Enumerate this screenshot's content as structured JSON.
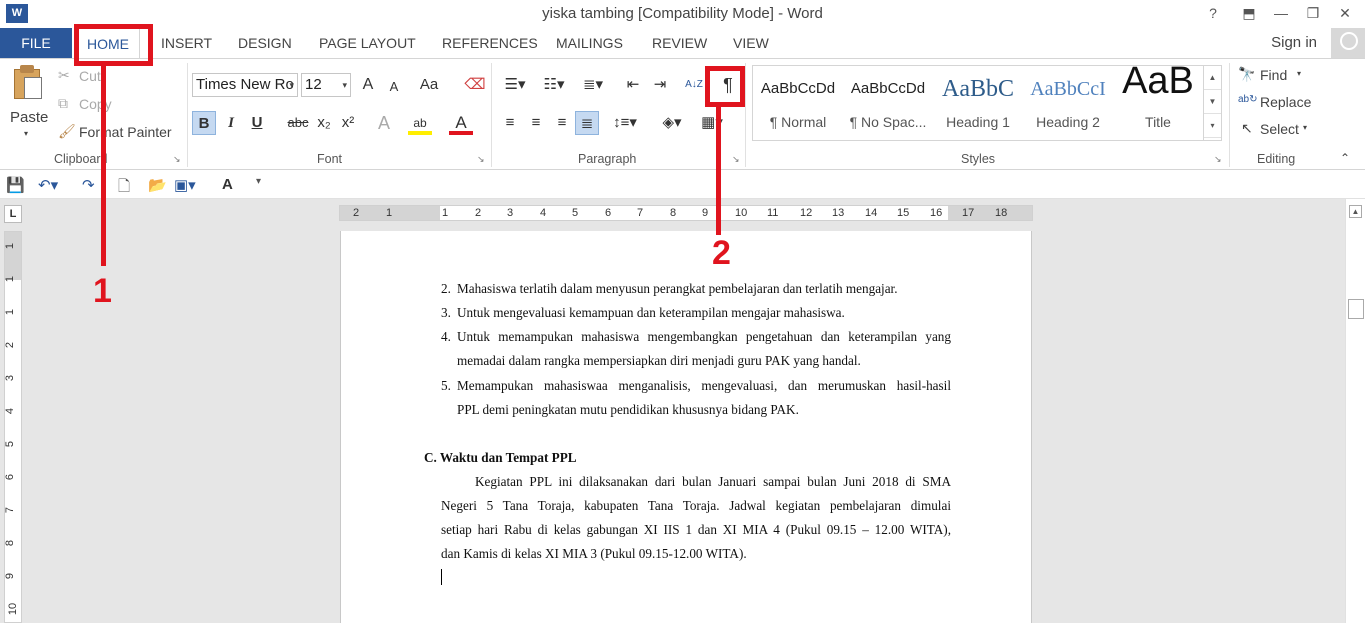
{
  "window": {
    "title": "yiska tambing [Compatibility Mode] - Word",
    "logo": "W",
    "help": "?",
    "restore_ribbon": "⬒",
    "minimize": "—",
    "maximize": "❐",
    "close": "✕"
  },
  "tabs": {
    "file": "FILE",
    "home": "HOME",
    "insert": "INSERT",
    "design": "DESIGN",
    "page_layout": "PAGE LAYOUT",
    "references": "REFERENCES",
    "mailings": "MAILINGS",
    "review": "REVIEW",
    "view": "VIEW",
    "sign_in": "Sign in"
  },
  "clipboard": {
    "paste": "Paste",
    "cut": "Cut",
    "copy": "Copy",
    "format_painter": "Format Painter",
    "label": "Clipboard"
  },
  "font": {
    "name": "Times New Ro",
    "size": "12",
    "grow": "A",
    "shrink": "A",
    "change_case": "Aa",
    "bold": "B",
    "italic": "I",
    "underline": "U",
    "strike": "abc",
    "subscript": "x₂",
    "superscript": "x²",
    "effects": "A",
    "highlight": "ab",
    "color": "A",
    "label": "Font"
  },
  "paragraph": {
    "show_hide": "¶",
    "sort": "A↓Z",
    "label": "Paragraph"
  },
  "styles": {
    "items": [
      {
        "sample": "AaBbCcDd",
        "name": "¶ Normal"
      },
      {
        "sample": "AaBbCcDd",
        "name": "¶ No Spac..."
      },
      {
        "sample": "AaBbC",
        "name": "Heading 1"
      },
      {
        "sample": "AaBbCcI",
        "name": "Heading 2"
      },
      {
        "sample": "AaB",
        "name": "Title"
      }
    ],
    "label": "Styles"
  },
  "editing": {
    "find": "Find",
    "replace": "Replace",
    "select": "Select",
    "label": "Editing"
  },
  "ruler": {
    "corner": "L",
    "h_numbers": [
      "2",
      "1",
      "1",
      "2",
      "3",
      "4",
      "5",
      "6",
      "7",
      "8",
      "9",
      "10",
      "11",
      "12",
      "13",
      "14",
      "15",
      "16",
      "17",
      "18"
    ],
    "v_numbers": [
      "1",
      "1",
      "1",
      "2",
      "3",
      "4",
      "5",
      "6",
      "7",
      "8",
      "9",
      "10"
    ]
  },
  "document": {
    "items": [
      {
        "num": "2.",
        "text": "Mahasiswa terlatih dalam menyusun perangkat pembelajaran dan terlatih mengajar."
      },
      {
        "num": "3.",
        "text": "Untuk mengevaluasi kemampuan dan keterampilan mengajar mahasiswa."
      },
      {
        "num": "4.",
        "line1": "Untuk memampukan mahasiswa mengembangkan pengetahuan dan keterampilan yang",
        "line2": "memadai dalam rangka mempersiapkan diri menjadi guru PAK yang handal."
      },
      {
        "num": "5.",
        "line1": "Memampukan mahasiswaa menganalisis, mengevaluasi, dan merumuskan hasil-hasil",
        "line2": "PPL demi peningkatan mutu pendidikan khususnya bidang PAK."
      }
    ],
    "heading": "C. Waktu dan Tempat PPL",
    "para_lines": [
      "Kegiatan PPL ini dilaksanakan dari bulan Januari sampai bulan Juni 2018 di SMA",
      "Negeri 5 Tana Toraja, kabupaten Tana Toraja. Jadwal kegiatan pembelajaran dimulai",
      "setiap hari Rabu di kelas gabungan XI IIS 1 dan XI MIA 4 (Pukul 09.15 – 12.00 WITA),",
      "dan Kamis di kelas XI MIA 3 (Pukul 09.15-12.00 WITA)."
    ]
  },
  "annotations": {
    "one": "1",
    "two": "2",
    "color": "#e0141e"
  }
}
